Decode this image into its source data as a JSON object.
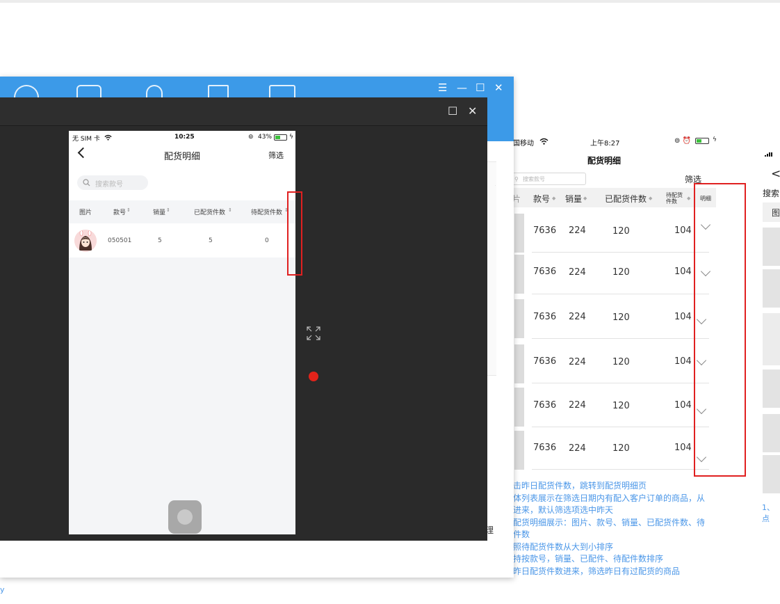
{
  "mockup": {
    "status": {
      "carrier": "国移动",
      "time": "上午8:27"
    },
    "title": "配货明细",
    "search_placeholder": "搜索款号",
    "filter": "筛选",
    "headers": [
      "款号",
      "销量",
      "已配货件数",
      "待配货件数",
      "明细"
    ],
    "header_icon": "sort-icon",
    "rows": [
      {
        "code": "7636",
        "sales": "224",
        "allocated": "120",
        "pending": "104"
      },
      {
        "code": "7636",
        "sales": "224",
        "allocated": "120",
        "pending": "104"
      },
      {
        "code": "7636",
        "sales": "224",
        "allocated": "120",
        "pending": "104"
      },
      {
        "code": "7636",
        "sales": "224",
        "allocated": "120",
        "pending": "104"
      },
      {
        "code": "7636",
        "sales": "224",
        "allocated": "120",
        "pending": "104"
      },
      {
        "code": "7636",
        "sales": "224",
        "allocated": "120",
        "pending": "104"
      }
    ],
    "notes": [
      "击昨日配货件数，跳转到配货明细页",
      "体列表展示在筛选日期内有配入客户订单的商品，从",
      "进来，默认筛选项选中昨天",
      "配货明细展示：图片、款号、销量、已配货件数、待",
      "件数",
      "照待配货件数从大到小排序",
      "持按款号，销量、已配件、待配件数排序",
      "昨日配货件数进来，筛选昨日有过配货的商品"
    ]
  },
  "far_right": {
    "back": "<",
    "search": "搜索",
    "image": "图",
    "note": "1、点"
  },
  "bottom_left_text": "y",
  "bg_window": {
    "stray": "理"
  },
  "blue_window": {
    "controls": [
      "☰",
      "—",
      "☐",
      "✕"
    ]
  },
  "dark_window": {
    "controls": [
      "☐",
      "✕"
    ]
  },
  "phone": {
    "status": {
      "carrier": "无 SIM 卡",
      "time": "10:25",
      "battery": "43%"
    },
    "title": "配货明细",
    "filter": "筛选",
    "search_placeholder": "搜索款号",
    "headers": [
      "图片",
      "款号",
      "销量",
      "已配货件数",
      "待配货件数"
    ],
    "sort_mark": "⇕",
    "row": {
      "code": "050501",
      "sales": "5",
      "allocated": "5",
      "pending": "0"
    }
  },
  "colors": {
    "accent_blue": "#3c9ae8",
    "note_blue": "#4b97e8",
    "highlight_red": "#e02020",
    "record_red": "#e2231a"
  }
}
